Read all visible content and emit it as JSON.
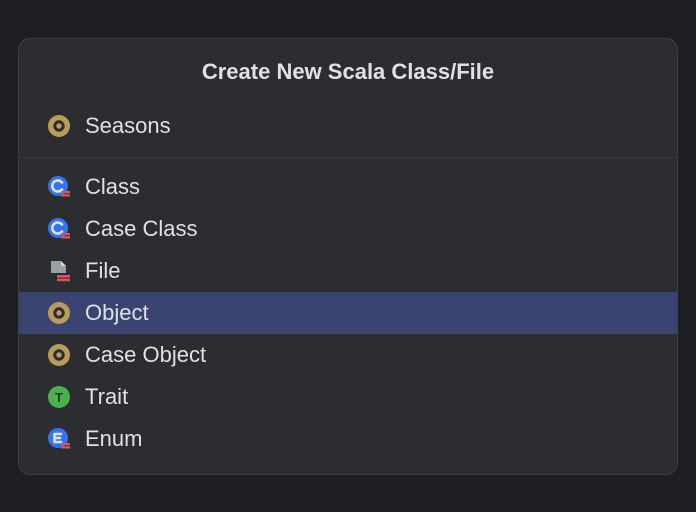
{
  "dialog": {
    "title": "Create New Scala Class/File",
    "inputValue": "Seasons",
    "selectedIndex": 3,
    "options": [
      {
        "key": "class",
        "label": "Class",
        "iconType": "class"
      },
      {
        "key": "case-class",
        "label": "Case Class",
        "iconType": "class"
      },
      {
        "key": "file",
        "label": "File",
        "iconType": "file"
      },
      {
        "key": "object",
        "label": "Object",
        "iconType": "object"
      },
      {
        "key": "case-object",
        "label": "Case Object",
        "iconType": "object"
      },
      {
        "key": "trait",
        "label": "Trait",
        "iconType": "trait"
      },
      {
        "key": "enum",
        "label": "Enum",
        "iconType": "enum"
      }
    ]
  }
}
